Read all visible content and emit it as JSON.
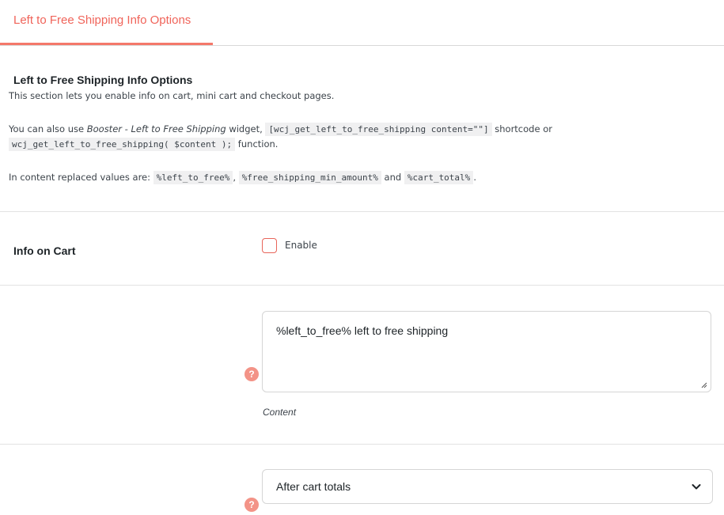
{
  "tab": {
    "label": "Left to Free Shipping Info Options"
  },
  "section": {
    "title": "Left to Free Shipping Info Options",
    "description": "This section lets you enable info on cart, mini cart and checkout pages.",
    "para2": {
      "t1": "You can also use ",
      "em": "Booster - Left to Free Shipping",
      "t2": " widget, ",
      "code1": "[wcj_get_left_to_free_shipping content=\"\"]",
      "t3": " shortcode or",
      "code2": "wcj_get_left_to_free_shipping( $content );",
      "t4": " function."
    },
    "para3": {
      "t1": "In content replaced values are: ",
      "code1": "%left_to_free%",
      "t2": ", ",
      "code2": "%free_shipping_min_amount%",
      "t3": " and ",
      "code3": "%cart_total%",
      "t4": "."
    }
  },
  "info_on_cart": {
    "label": "Info on Cart",
    "checkbox_label": "Enable",
    "checked": false
  },
  "content_field": {
    "value": "%left_to_free% left to free shipping",
    "description": "Content",
    "help_icon": "question-mark-icon"
  },
  "position_field": {
    "selected": "After cart totals",
    "help_icon": "question-mark-icon",
    "dropdown_icon": "chevron-down-icon"
  },
  "colors": {
    "accent": "#f0645a",
    "help_icon": "#f39387"
  }
}
